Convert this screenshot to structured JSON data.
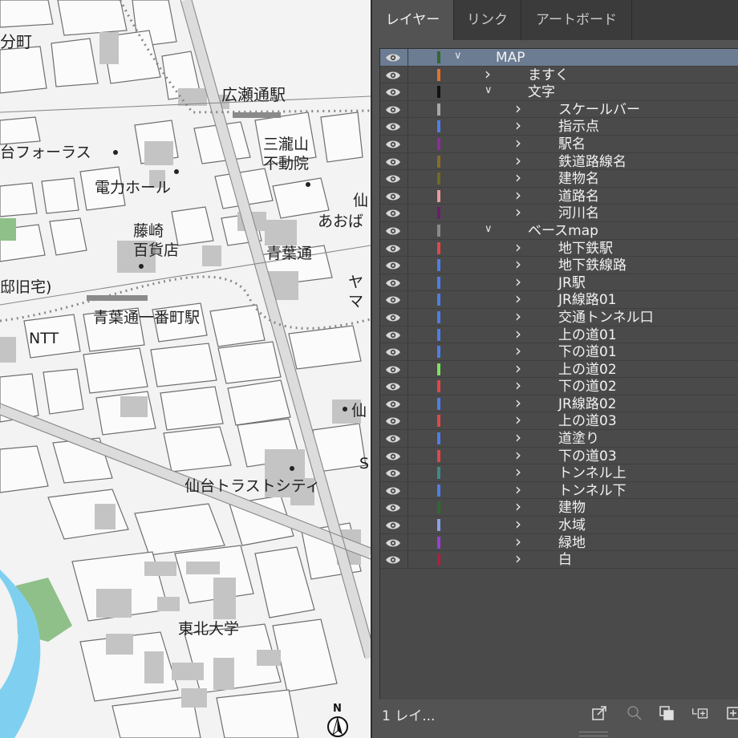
{
  "map": {
    "labels": {
      "area1": "分町",
      "station1": "広瀬通駅",
      "building1": "台フォーラス",
      "temple": "三瀧山\n不動院",
      "building2": "電力ホール",
      "dept": "藤崎\n百貨店",
      "cut1": "仙",
      "cut2": "あおば",
      "road1": "青葉通",
      "cut3": "ヤマ",
      "cut4": "邸旧宅)",
      "station2": "青葉通一番町駅",
      "ntt": "NTT",
      "cut5": "仙",
      "cut6": "S",
      "trust": "仙台トラストシティ",
      "univ": "東北大学",
      "north": "N"
    }
  },
  "panel": {
    "tabs": [
      {
        "label": "レイヤー",
        "active": true
      },
      {
        "label": "リンク",
        "active": false
      },
      {
        "label": "アートボード",
        "active": false
      }
    ],
    "layers": [
      {
        "name": "MAP",
        "depth": 0,
        "expanded": true,
        "selected": true,
        "color": "#2e6a2e"
      },
      {
        "name": "ますく",
        "depth": 1,
        "expanded": false,
        "color": "#e0742c"
      },
      {
        "name": "文字",
        "depth": 1,
        "expanded": true,
        "color": "#111111"
      },
      {
        "name": "スケールバー",
        "depth": 2,
        "expanded": false,
        "color": "#a8a8a8"
      },
      {
        "name": "指示点",
        "depth": 2,
        "expanded": false,
        "color": "#4e7ee6"
      },
      {
        "name": "駅名",
        "depth": 2,
        "expanded": false,
        "color": "#8a2f9a"
      },
      {
        "name": "鉄道路線名",
        "depth": 2,
        "expanded": false,
        "color": "#8a6a2a"
      },
      {
        "name": "建物名",
        "depth": 2,
        "expanded": false,
        "color": "#6f6a26"
      },
      {
        "name": "道路名",
        "depth": 2,
        "expanded": false,
        "color": "#e89a9a"
      },
      {
        "name": "河川名",
        "depth": 2,
        "expanded": false,
        "color": "#6a1f6a"
      },
      {
        "name": "ベースmap",
        "depth": 1,
        "expanded": true,
        "color": "#8a8a8a"
      },
      {
        "name": "地下鉄駅",
        "depth": 2,
        "expanded": false,
        "color": "#e04848"
      },
      {
        "name": "地下鉄線路",
        "depth": 2,
        "expanded": false,
        "color": "#4e7ee6"
      },
      {
        "name": "JR駅",
        "depth": 2,
        "expanded": false,
        "color": "#4e7ee6"
      },
      {
        "name": "JR線路01",
        "depth": 2,
        "expanded": false,
        "color": "#4e7ee6"
      },
      {
        "name": "交通トンネル口",
        "depth": 2,
        "expanded": false,
        "color": "#4e7ee6"
      },
      {
        "name": "上の道01",
        "depth": 2,
        "expanded": false,
        "color": "#4e7ee6"
      },
      {
        "name": "下の道01",
        "depth": 2,
        "expanded": false,
        "color": "#4e7ee6"
      },
      {
        "name": "上の道02",
        "depth": 2,
        "expanded": false,
        "color": "#7fe060"
      },
      {
        "name": "下の道02",
        "depth": 2,
        "expanded": false,
        "color": "#e04848"
      },
      {
        "name": "JR線路02",
        "depth": 2,
        "expanded": false,
        "color": "#4e7ee6"
      },
      {
        "name": "上の道03",
        "depth": 2,
        "expanded": false,
        "color": "#e04848"
      },
      {
        "name": "道塗り",
        "depth": 2,
        "expanded": false,
        "color": "#4e7ee6"
      },
      {
        "name": "下の道03",
        "depth": 2,
        "expanded": false,
        "color": "#e04848"
      },
      {
        "name": "トンネル上",
        "depth": 2,
        "expanded": false,
        "color": "#3f8a8a"
      },
      {
        "name": "トンネル下",
        "depth": 2,
        "expanded": false,
        "color": "#4e7ee6"
      },
      {
        "name": "建物",
        "depth": 2,
        "expanded": false,
        "color": "#2e6a2e"
      },
      {
        "name": "水域",
        "depth": 2,
        "expanded": false,
        "color": "#8aa0e6"
      },
      {
        "name": "緑地",
        "depth": 2,
        "expanded": false,
        "color": "#9a3fd0"
      },
      {
        "name": "白",
        "depth": 2,
        "expanded": false,
        "color": "#b0203a"
      }
    ],
    "footer": {
      "layer_count": "1 レイ..."
    },
    "icons": [
      "export-icon",
      "search-icon",
      "clipping-mask-icon",
      "new-sublayer-icon",
      "new-layer-icon"
    ]
  }
}
